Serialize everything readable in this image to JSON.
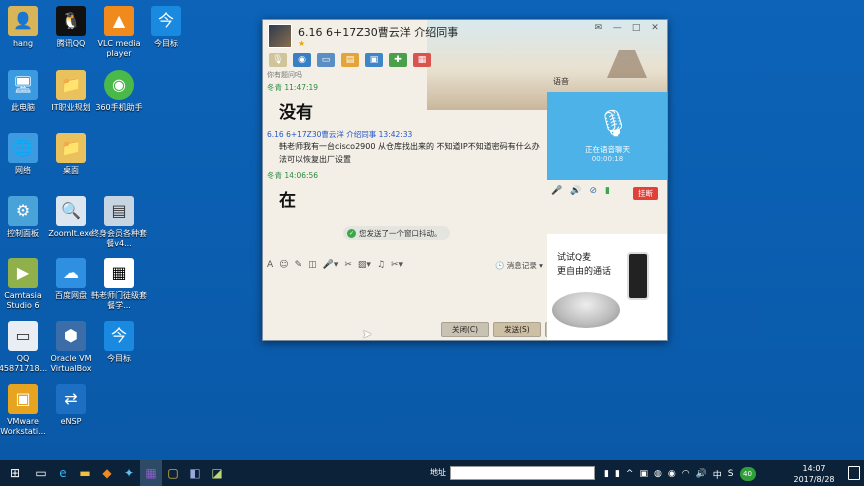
{
  "desktop": {
    "icons": [
      {
        "label": "hang",
        "icon": "user-folder-icon"
      },
      {
        "label": "腾讯QQ",
        "icon": "qq-penguin-icon"
      },
      {
        "label": "VLC media player",
        "icon": "vlc-cone-icon"
      },
      {
        "label": "今目标",
        "icon": "jinmubiao-icon"
      },
      {
        "label": "此电脑",
        "icon": "computer-icon"
      },
      {
        "label": "IT职业规划",
        "icon": "folder-icon"
      },
      {
        "label": "360手机助手",
        "icon": "360-assistant-icon"
      },
      {
        "label": "网络",
        "icon": "network-icon"
      },
      {
        "label": "桌面",
        "icon": "folder-icon"
      },
      {
        "label": "控制面板",
        "icon": "control-panel-icon"
      },
      {
        "label": "ZoomIt.exe",
        "icon": "zoomit-icon"
      },
      {
        "label": "终身会员各种套餐v4...",
        "icon": "document-icon"
      },
      {
        "label": "Camtasia Studio 6",
        "icon": "camtasia-icon"
      },
      {
        "label": "百度网盘",
        "icon": "baidu-cloud-icon"
      },
      {
        "label": "韩老师门徒级套餐学...",
        "icon": "qr-document-icon"
      },
      {
        "label": "QQ 45871718...",
        "icon": "qq-window-icon"
      },
      {
        "label": "Oracle VM VirtualBox",
        "icon": "virtualbox-icon"
      },
      {
        "label": "今目标",
        "icon": "jinmubiao-icon"
      },
      {
        "label": "VMware Workstati...",
        "icon": "vmware-icon"
      },
      {
        "label": "eNSP",
        "icon": "ensp-icon"
      }
    ]
  },
  "qq_window": {
    "title": "6.16    6+17Z30曹云洋 介绍同事",
    "window_buttons": [
      "✉",
      "—",
      "□",
      "✕"
    ],
    "chat": {
      "partial_top": "你有题问吗",
      "messages": [
        {
          "sender": "冬青",
          "time": "11:47:19",
          "text": "没有",
          "big": true,
          "me": false
        },
        {
          "sender": "6.16    6+17Z30曹云洋 介绍同事",
          "time": "13:42:33",
          "text": "韩老师我有一台cisco2900  从仓库找出来的 不知道IP不知道密码有什么办法可以恢复出厂设置",
          "big": false,
          "me": true
        },
        {
          "sender": "冬青",
          "time": "14:06:56",
          "text": "在",
          "big": true,
          "me": false
        }
      ],
      "notice": "您发送了一个窗口抖动。"
    },
    "history_label": "消息记录",
    "close_button": "关闭(C)",
    "send_button": "发送(S)",
    "side": {
      "tab_label": "语音",
      "voice_status": "正在语音聊天",
      "voice_timer": "00:00:18",
      "hangup_label": "挂断",
      "ad_line1": "试试Q麦",
      "ad_line2": "更自由的通话"
    }
  },
  "taskbar": {
    "address_label": "地址",
    "tray_ime": "中",
    "tray_badge": "40",
    "time": "14:07",
    "date": "2017/8/28"
  }
}
